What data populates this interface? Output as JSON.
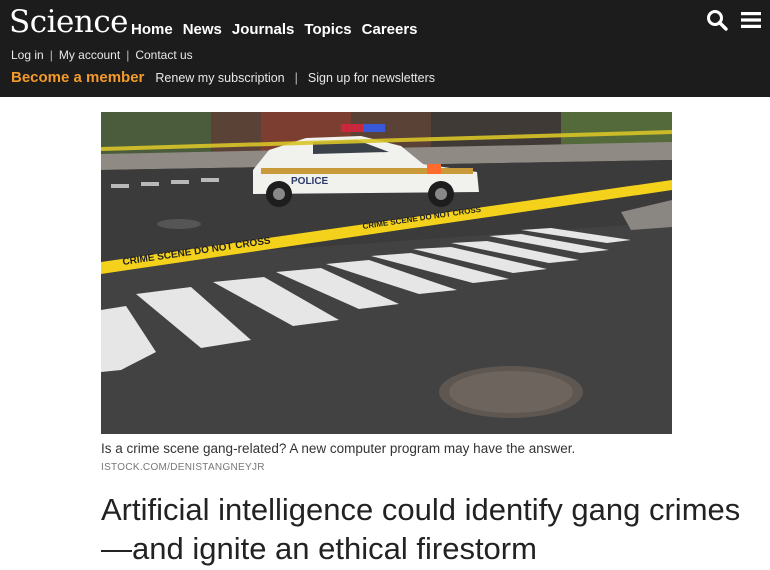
{
  "brand": {
    "logo": "Science"
  },
  "nav": {
    "items": [
      "Home",
      "News",
      "Journals",
      "Topics",
      "Careers"
    ]
  },
  "account": {
    "login": "Log in",
    "my_account": "My account",
    "contact": "Contact us"
  },
  "membership": {
    "become_member": "Become a member",
    "renew": "Renew my subscription",
    "newsletters": "Sign up for newsletters"
  },
  "icons": {
    "search": "search-icon",
    "menu": "hamburger-menu-icon"
  },
  "hero": {
    "tape_text": "CRIME SCENE DO NOT CROSS",
    "car_text": "POLICE",
    "caption": "Is a crime scene gang-related? A new computer program may have the answer.",
    "credit": "ISTOCK.COM/DENISTANGNEYJR"
  },
  "article": {
    "headline": "Artificial intelligence could identify gang crimes—and ignite an ethical firestorm"
  },
  "colors": {
    "header_bg": "#1c1c1c",
    "accent": "#f39a2b",
    "tape": "#f4d21c"
  }
}
